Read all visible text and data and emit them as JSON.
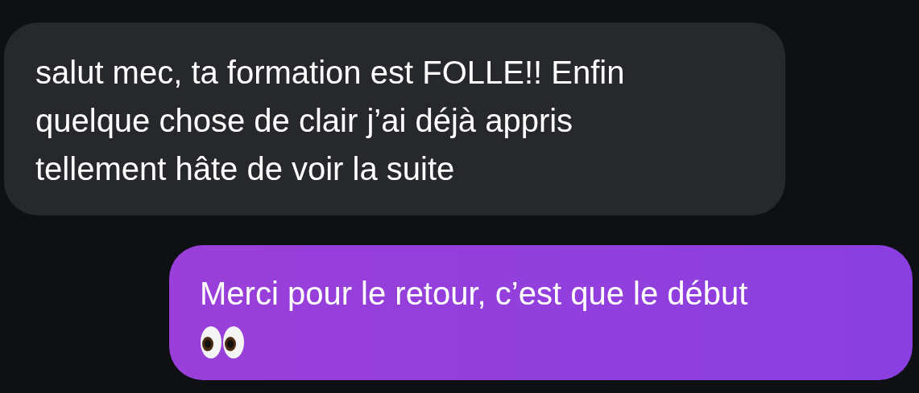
{
  "messages": [
    {
      "kind": "incoming",
      "text": "salut mec, ta formation est FOLLE!! Enfin\nquelque chose de clair j’ai déjà appris\ntellement hâte de voir la suite"
    },
    {
      "kind": "outgoing",
      "text": "Merci pour le retour, c’est que le début",
      "eyes_icon": true
    }
  ]
}
